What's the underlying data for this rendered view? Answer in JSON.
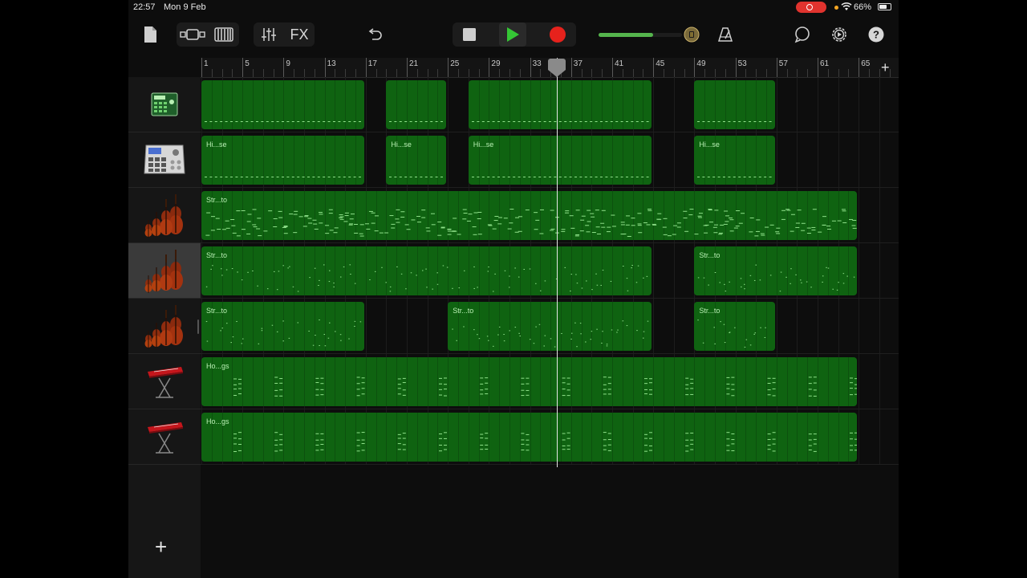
{
  "status_bar": {
    "time": "22:57",
    "date": "Mon 9 Feb",
    "battery": "66%",
    "battery_level": 0.66
  },
  "toolbar": {
    "fx_label": "FX",
    "master_volume": 0.65,
    "icons": [
      "document-icon",
      "tracks-view-icon",
      "keyboard-icon",
      "mixer-icon",
      "undo-icon",
      "stop-icon",
      "play-icon",
      "record-icon",
      "master-volume-knob-icon",
      "metronome-icon",
      "loop-icon",
      "settings-icon",
      "help-icon"
    ]
  },
  "colors": {
    "region": "#0f6311",
    "region_text": "#b9f0b4",
    "play": "#35c735",
    "record": "#e6221c",
    "accent_volume": "#54b44c"
  },
  "ruler": {
    "labels": [
      "1",
      "5",
      "9",
      "13",
      "17",
      "21",
      "25",
      "29",
      "33",
      "37",
      "41",
      "45",
      "49",
      "53",
      "57",
      "61",
      "65"
    ]
  },
  "playhead_bar": 35.6,
  "tracks": [
    {
      "instrument_icon": "drum-machine-icon",
      "selected": false,
      "regions": [
        {
          "start": 1,
          "end": 17,
          "label": ""
        },
        {
          "start": 19,
          "end": 25,
          "label": ""
        },
        {
          "start": 27,
          "end": 45,
          "label": ""
        },
        {
          "start": 49,
          "end": 57,
          "label": ""
        }
      ]
    },
    {
      "instrument_icon": "beat-sequencer-icon",
      "selected": false,
      "regions": [
        {
          "start": 1,
          "end": 17,
          "label": "Hi...se"
        },
        {
          "start": 19,
          "end": 25,
          "label": "Hi...se"
        },
        {
          "start": 27,
          "end": 45,
          "label": "Hi...se"
        },
        {
          "start": 49,
          "end": 57,
          "label": "Hi...se"
        }
      ]
    },
    {
      "instrument_icon": "strings-icon",
      "selected": false,
      "regions": [
        {
          "start": 1,
          "end": 65,
          "label": "Str...to"
        }
      ]
    },
    {
      "instrument_icon": "strings-icon",
      "selected": true,
      "regions": [
        {
          "start": 1,
          "end": 45,
          "label": "Str...to"
        },
        {
          "start": 49,
          "end": 65,
          "label": "Str...to"
        }
      ]
    },
    {
      "instrument_icon": "strings-icon",
      "selected": false,
      "regions": [
        {
          "start": 1,
          "end": 17,
          "label": "Str...to"
        },
        {
          "start": 25,
          "end": 45,
          "label": "Str...to"
        },
        {
          "start": 49,
          "end": 57,
          "label": "Str...to"
        }
      ]
    },
    {
      "instrument_icon": "keyboard-stand-icon",
      "selected": false,
      "regions": [
        {
          "start": 1,
          "end": 65,
          "label": "Ho...gs"
        }
      ]
    },
    {
      "instrument_icon": "keyboard-stand-icon",
      "selected": false,
      "regions": [
        {
          "start": 1,
          "end": 65,
          "label": "Ho...gs"
        }
      ]
    }
  ]
}
